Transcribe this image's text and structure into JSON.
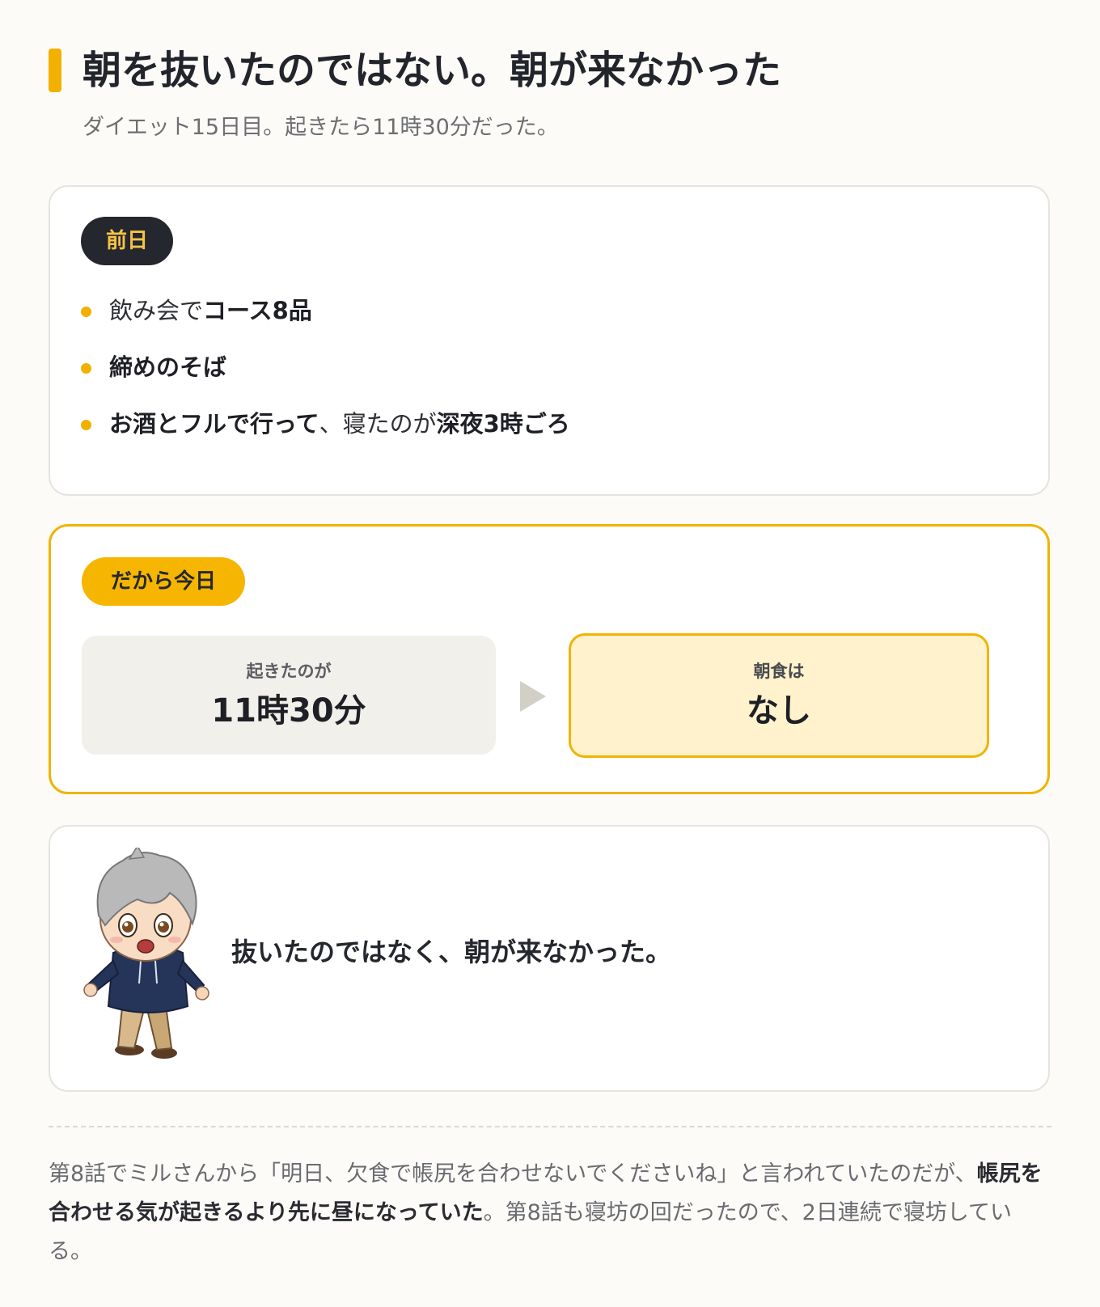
{
  "title": "朝を抜いたのではない。朝が来なかった",
  "subtitle": "ダイエット15日目。起きたら11時30分だった。",
  "previous_day": {
    "pill": "前日",
    "bullets": [
      {
        "normal_before": "飲み会で",
        "bold": "コース8品",
        "normal_after": "",
        "bold_after": ""
      },
      {
        "normal_before": "",
        "bold": "締めのそば",
        "normal_after": "",
        "bold_after": ""
      },
      {
        "normal_before": "",
        "bold": "お酒とフルで行って",
        "normal_after": "、寝たのが",
        "bold_after": "深夜3時ごろ"
      }
    ]
  },
  "today": {
    "pill": "だから今日",
    "wake": {
      "label": "起きたのが",
      "value": "11時30分"
    },
    "breakfast": {
      "label": "朝食は",
      "value": "なし"
    }
  },
  "character_line": "抜いたのではなく、朝が来なかった。",
  "note": {
    "part1": "第8話でミルさんから「明日、欠食で帳尻を合わせないでくださいね」と言われていたのだが、",
    "bold": "帳尻を合わせる気が起きるより先に昼になっていた",
    "part2": "。第8話も寝坊の回だったので、2日連続で寝坊している。"
  },
  "colors": {
    "accent": "#f2b000",
    "dark_pill": "#25272e",
    "highlight_box": "#fff2cc",
    "background": "#fcfbf8"
  }
}
